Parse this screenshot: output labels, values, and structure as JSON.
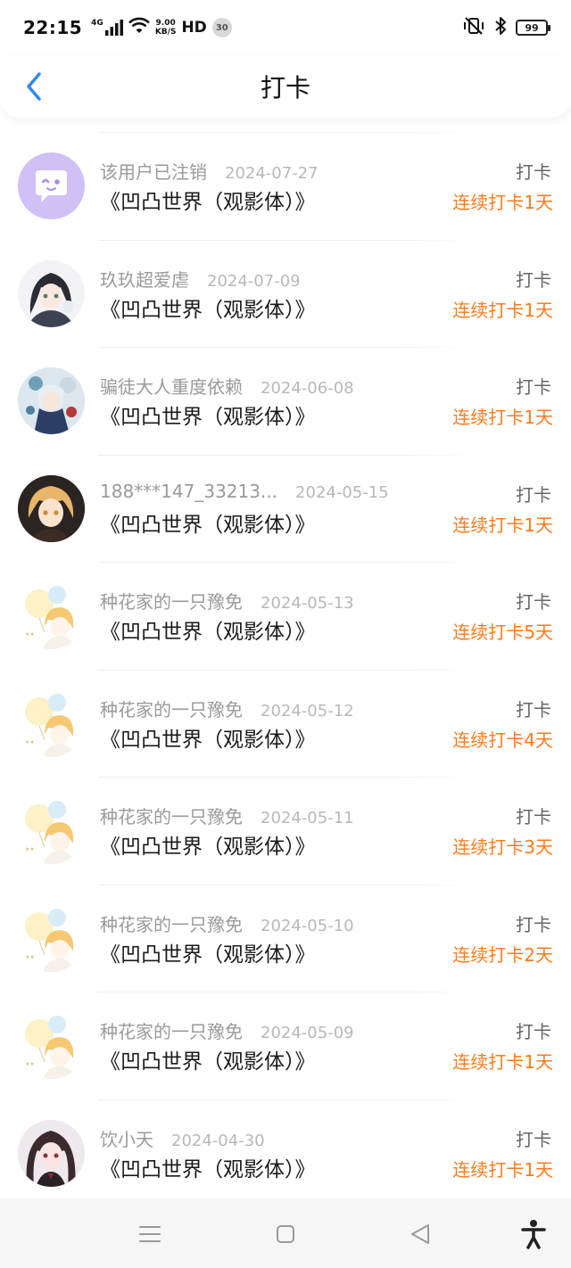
{
  "status_bar": {
    "time": "22:15",
    "network": "4G",
    "speed_value": "9.00",
    "speed_unit": "KB/S",
    "hd": "HD",
    "notification_count": "30",
    "battery": "99"
  },
  "header": {
    "title": "打卡"
  },
  "colors": {
    "accent_blue": "#2a8cf0",
    "streak_orange": "#ff7a1a"
  },
  "checkins": [
    {
      "user": "该用户已注销",
      "date": "2024-07-27",
      "book": "《凹凸世界（观影体）》",
      "action": "打卡",
      "streak": "连续打卡1天",
      "avatar_icon": "chat-bubble-avatar"
    },
    {
      "user": "玖玖超爱虐",
      "date": "2024-07-09",
      "book": "《凹凸世界（观影体）》",
      "action": "打卡",
      "streak": "连续打卡1天",
      "avatar_icon": "anime-girl-avatar"
    },
    {
      "user": "骗徒大人重度依赖",
      "date": "2024-06-08",
      "book": "《凹凸世界（观影体）》",
      "action": "打卡",
      "streak": "连续打卡1天",
      "avatar_icon": "anime-character-avatar"
    },
    {
      "user": "188***147_33213...",
      "date": "2024-05-15",
      "book": "《凹凸世界（观影体）》",
      "action": "打卡",
      "streak": "连续打卡1天",
      "avatar_icon": "anime-boy-avatar"
    },
    {
      "user": "种花家的一只豫免",
      "date": "2024-05-13",
      "book": "《凹凸世界（观影体）》",
      "action": "打卡",
      "streak": "连续打卡5天",
      "avatar_icon": "balloon-boy-avatar"
    },
    {
      "user": "种花家的一只豫免",
      "date": "2024-05-12",
      "book": "《凹凸世界（观影体）》",
      "action": "打卡",
      "streak": "连续打卡4天",
      "avatar_icon": "balloon-boy-avatar"
    },
    {
      "user": "种花家的一只豫免",
      "date": "2024-05-11",
      "book": "《凹凸世界（观影体）》",
      "action": "打卡",
      "streak": "连续打卡3天",
      "avatar_icon": "balloon-boy-avatar"
    },
    {
      "user": "种花家的一只豫免",
      "date": "2024-05-10",
      "book": "《凹凸世界（观影体）》",
      "action": "打卡",
      "streak": "连续打卡2天",
      "avatar_icon": "balloon-boy-avatar"
    },
    {
      "user": "种花家的一只豫免",
      "date": "2024-05-09",
      "book": "《凹凸世界（观影体）》",
      "action": "打卡",
      "streak": "连续打卡1天",
      "avatar_icon": "balloon-boy-avatar"
    },
    {
      "user": "饮小天",
      "date": "2024-04-30",
      "book": "《凹凸世界（观影体）》",
      "action": "打卡",
      "streak": "连续打卡1天",
      "avatar_icon": "dark-hair-girl-avatar"
    }
  ],
  "nav_bar": {
    "icons": [
      "menu-icon",
      "home-square-icon",
      "back-triangle-icon",
      "accessibility-icon"
    ]
  }
}
